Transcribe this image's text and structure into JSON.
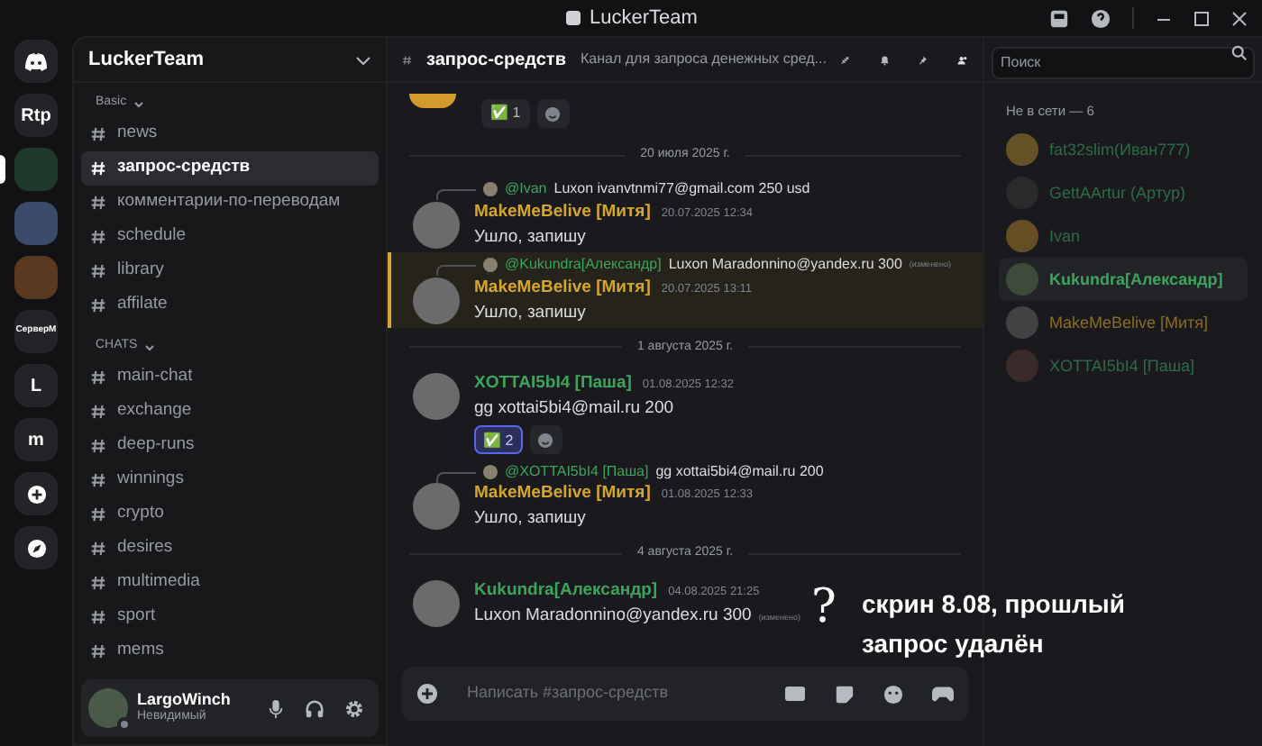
{
  "window": {
    "title": "LuckerTeam"
  },
  "servers": [
    {
      "kind": "logo",
      "selected": false
    },
    {
      "kind": "text",
      "label": "Rtp",
      "selected": false
    },
    {
      "kind": "image",
      "selected": true
    },
    {
      "kind": "image",
      "selected": false
    },
    {
      "kind": "image",
      "selected": false
    },
    {
      "kind": "small-text",
      "label": "СерверМ",
      "selected": false
    },
    {
      "kind": "text",
      "label": "L",
      "selected": false
    },
    {
      "kind": "text",
      "label": "m",
      "selected": false
    },
    {
      "kind": "add",
      "selected": false
    },
    {
      "kind": "explore",
      "selected": false
    }
  ],
  "guild": {
    "name": "LuckerTeam"
  },
  "categories": [
    {
      "name": "Basic",
      "channels": [
        {
          "name": "news",
          "selected": false
        },
        {
          "name": "запрос-средств",
          "selected": true
        },
        {
          "name": "комментарии-по-переводам",
          "selected": false
        },
        {
          "name": "schedule",
          "selected": false
        },
        {
          "name": "library",
          "selected": false
        },
        {
          "name": "affilate",
          "selected": false
        }
      ]
    },
    {
      "name": "CHATS",
      "channels": [
        {
          "name": "main-chat",
          "selected": false
        },
        {
          "name": "exchange",
          "selected": false
        },
        {
          "name": "deep-runs",
          "selected": false
        },
        {
          "name": "winnings",
          "selected": false
        },
        {
          "name": "crypto",
          "selected": false
        },
        {
          "name": "desires",
          "selected": false
        },
        {
          "name": "multimedia",
          "selected": false
        },
        {
          "name": "sport",
          "selected": false
        },
        {
          "name": "mems",
          "selected": false
        }
      ]
    }
  ],
  "user": {
    "name": "LargoWinch",
    "status": "Невидимый"
  },
  "channel": {
    "name": "запрос-средств",
    "topic": "Канал для запроса денежных сред..."
  },
  "messages": [
    {
      "kind": "reactions",
      "reactions": [
        {
          "emoji": "✅",
          "count": "1",
          "selected": false
        }
      ]
    },
    {
      "kind": "divider",
      "text": "20 июля 2025 г."
    },
    {
      "kind": "message",
      "highlighted": false,
      "reply": {
        "author": "@Ivan",
        "color": "#3ba55c",
        "text": "Luxon ivanvtnmi77@gmail.com 250 usd"
      },
      "author": "MakeMeBelive [Митя]",
      "color": "#d4a72c",
      "time": "20.07.2025 12:34",
      "text": "Ушло, запишу"
    },
    {
      "kind": "message",
      "highlighted": true,
      "reply": {
        "author": "@Kukundra[Александр]",
        "color": "#3ba55c",
        "text": "Luxon Maradonnino@yandex.ru 300",
        "edited": "(изменено)"
      },
      "author": "MakeMeBelive [Митя]",
      "color": "#d4a72c",
      "time": "20.07.2025 13:11",
      "text": "Ушло, запишу"
    },
    {
      "kind": "divider",
      "text": "1 августа 2025 г."
    },
    {
      "kind": "message",
      "highlighted": false,
      "author": "XOTTAI5bI4 [Паша]",
      "color": "#3ba55c",
      "time": "01.08.2025 12:32",
      "text": "gg xottai5bi4@mail.ru 200",
      "reactions": [
        {
          "emoji": "✅",
          "count": "2",
          "selected": true
        }
      ]
    },
    {
      "kind": "message",
      "highlighted": false,
      "reply": {
        "author": "@XOTTAI5bI4 [Паша]",
        "color": "#3ba55c",
        "text": "gg xottai5bi4@mail.ru 200"
      },
      "author": "MakeMeBelive [Митя]",
      "color": "#d4a72c",
      "time": "01.08.2025 12:33",
      "text": "Ушло, запишу"
    },
    {
      "kind": "divider",
      "text": "4 августа 2025 г."
    },
    {
      "kind": "message",
      "highlighted": false,
      "author": "Kukundra[Александр]",
      "color": "#3ba55c",
      "time": "04.08.2025 21:25",
      "text": "Luxon Maradonnino@yandex.ru 300",
      "edited": "(изменено)"
    }
  ],
  "composer": {
    "placeholder": "Написать #запрос-средств"
  },
  "members": {
    "search_placeholder": "Поиск",
    "heading": "Не в сети — 6",
    "items": [
      {
        "name": "fat32slim(Иван777)",
        "color": "#2d6b45",
        "highlighted": false
      },
      {
        "name": "GettAArtur (Артур)",
        "color": "#2d6b45",
        "highlighted": false
      },
      {
        "name": "Ivan",
        "color": "#2d6b45",
        "highlighted": false
      },
      {
        "name": "Kukundra[Александр]",
        "color": "#3ba55c",
        "highlighted": true
      },
      {
        "name": "MakeMeBelive [Митя]",
        "color": "#8a6d22",
        "highlighted": false
      },
      {
        "name": "XOTTAI5bI4 [Паша]",
        "color": "#2d6b45",
        "highlighted": false
      }
    ]
  },
  "annotation": {
    "mark": "?",
    "text": "скрин 8.08, прошлый запрос удалён"
  }
}
